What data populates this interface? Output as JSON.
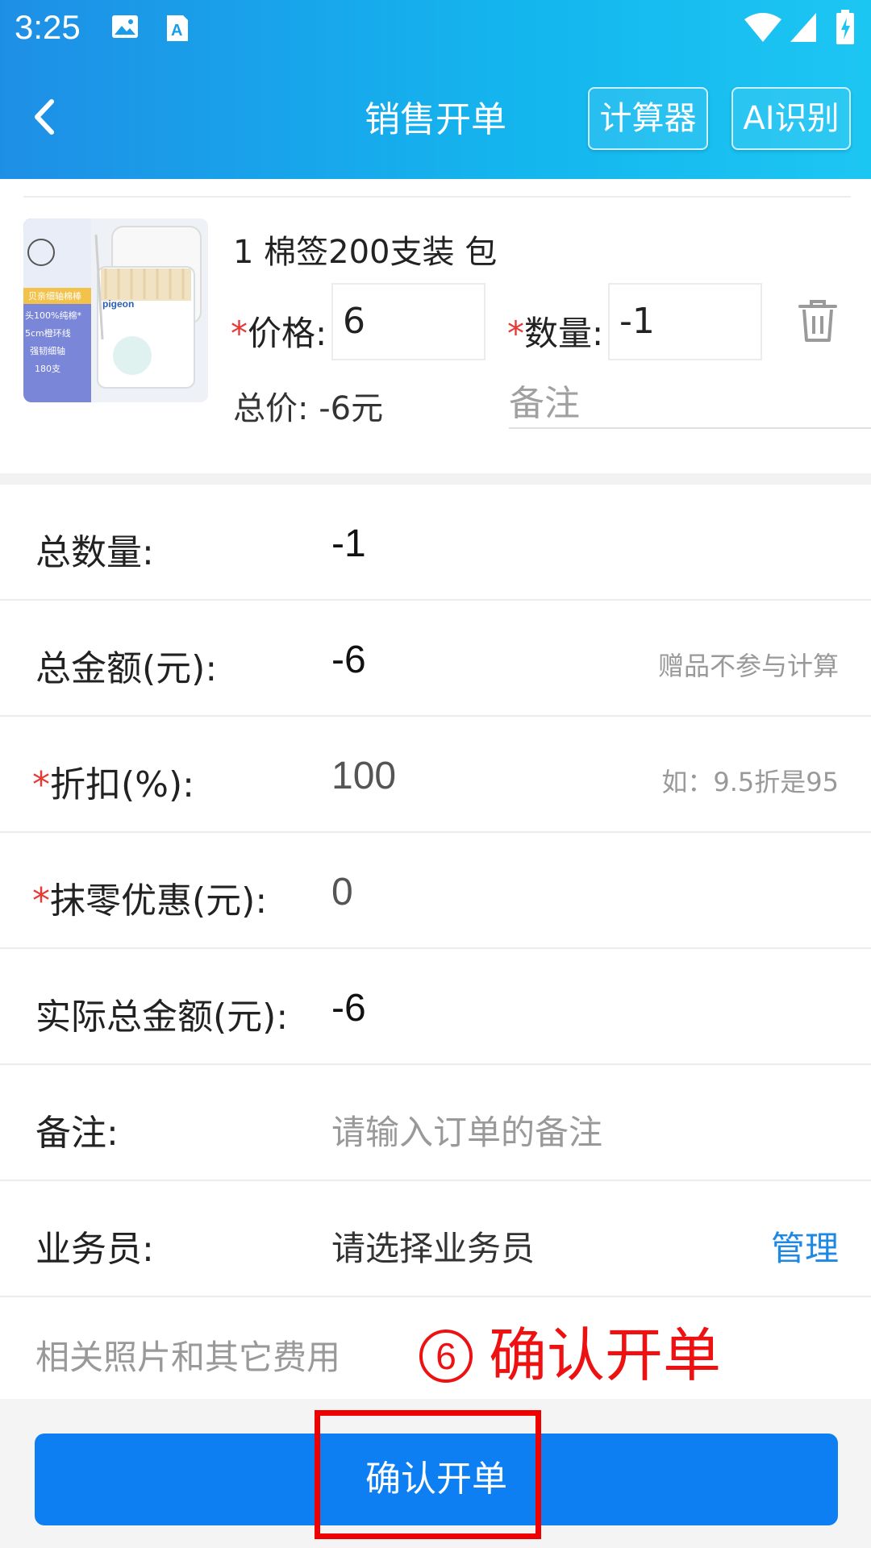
{
  "status_bar": {
    "time": "3:25"
  },
  "header": {
    "title": "销售开单",
    "calculator_label": "计算器",
    "ai_label": "AI识别"
  },
  "product": {
    "name": "1 棉签200支装 包",
    "price_label": "价格:",
    "price_value": "6",
    "qty_label": "数量:",
    "qty_value": "-1",
    "total_label": "总价: -6元",
    "remark_placeholder": "备注",
    "required_mark": "*",
    "image_texts": [
      "贝亲细轴棉棒",
      "pigeon",
      "头100%纯棉*",
      "5cm橙环线",
      "强韧细轴",
      "180支"
    ]
  },
  "form": {
    "total_qty_label": "总数量:",
    "total_qty_value": "-1",
    "total_amount_label": "总金额(元):",
    "total_amount_value": "-6",
    "total_amount_hint": "赠品不参与计算",
    "discount_label": "折扣(%):",
    "discount_value": "100",
    "discount_hint": "如：9.5折是95",
    "rounding_label": "抹零优惠(元):",
    "rounding_value": "0",
    "actual_total_label": "实际总金额(元):",
    "actual_total_value": "-6",
    "order_remark_label": "备注:",
    "order_remark_placeholder": "请输入订单的备注",
    "salesperson_label": "业务员:",
    "salesperson_placeholder": "请选择业务员",
    "manage_link": "管理",
    "photos_label": "相关照片和其它费用"
  },
  "annotation": {
    "step": "6",
    "text": "确认开单"
  },
  "confirm_button": "确认开单",
  "colors": {
    "header": "#1e8fe6",
    "primary_button": "#0d7ff2",
    "required": "#e53935",
    "annotation": "#ee1111"
  }
}
